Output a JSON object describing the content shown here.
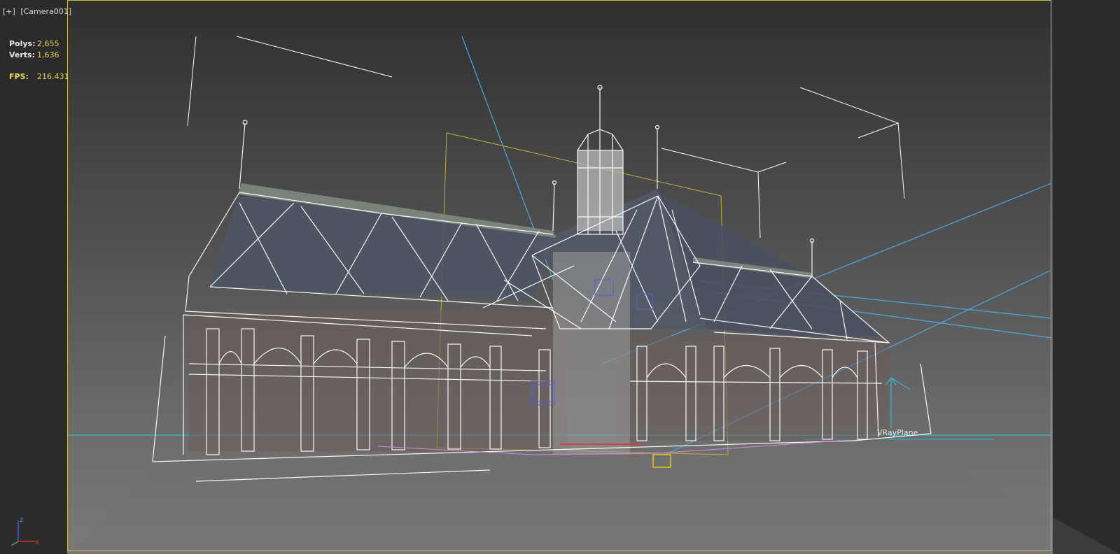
{
  "viewport": {
    "menu_label": "[+]",
    "camera_label": "[Camera001]"
  },
  "stats": {
    "polys_label": "Polys:",
    "polys_value": "2,655",
    "verts_label": "Verts:",
    "verts_value": "1,636",
    "fps_label": "FPS:",
    "fps_value": "216.431"
  },
  "scene": {
    "object_label": "VRayPlane",
    "gizmo_axis_z": "z",
    "gizmo_axis_x": "x"
  },
  "colors": {
    "safe_frame": "#c9c23a",
    "wireframe": "#ffffff",
    "camera_lines": "#4ba8e0",
    "ground_line": "#34b9c9",
    "stat_values": "#e8d55a"
  }
}
